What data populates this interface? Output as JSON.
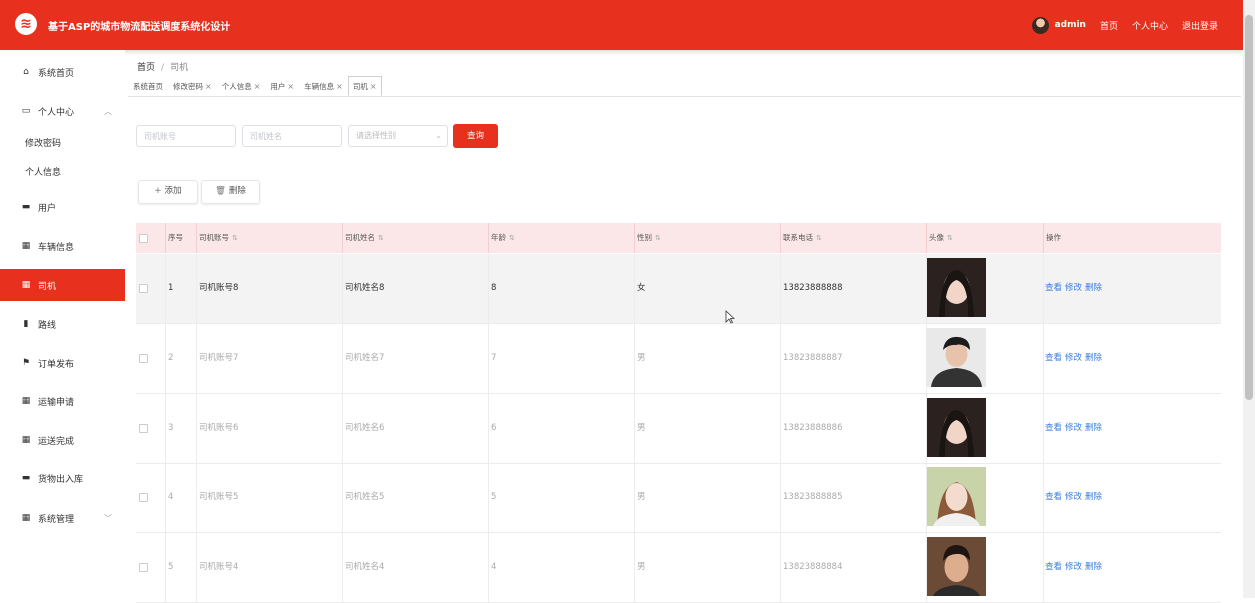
{
  "header": {
    "title": "基于ASP的城市物流配送调度系统化设计",
    "username": "admin",
    "links": [
      "首页",
      "个人中心",
      "退出登录"
    ]
  },
  "sidebar": {
    "items": [
      {
        "label": "系统首页",
        "icon": "home-icon"
      },
      {
        "label": "个人中心",
        "icon": "user-card-icon"
      },
      {
        "label": "用户",
        "icon": "monitor-icon"
      },
      {
        "label": "车辆信息",
        "icon": "grid-icon"
      },
      {
        "label": "司机",
        "icon": "grid-icon"
      },
      {
        "label": "路线",
        "icon": "clipboard-icon"
      },
      {
        "label": "订单发布",
        "icon": "flag-icon"
      },
      {
        "label": "运输申请",
        "icon": "grid-icon"
      },
      {
        "label": "运送完成",
        "icon": "grid-icon"
      },
      {
        "label": "货物出入库",
        "icon": "monitor-icon"
      },
      {
        "label": "系统管理",
        "icon": "grid-icon"
      }
    ],
    "sub_items": [
      "修改密码",
      "个人信息"
    ]
  },
  "breadcrumb": {
    "home": "首页",
    "separator": "/",
    "current": "司机"
  },
  "tabs": [
    {
      "label": "系统首页",
      "closable": false
    },
    {
      "label": "修改密码",
      "closable": true
    },
    {
      "label": "个人信息",
      "closable": true
    },
    {
      "label": "用户",
      "closable": true
    },
    {
      "label": "车辆信息",
      "closable": true
    },
    {
      "label": "司机",
      "closable": true,
      "active": true
    }
  ],
  "filters": {
    "account_placeholder": "司机账号",
    "name_placeholder": "司机姓名",
    "gender_placeholder": "请选择性别",
    "search_label": "查询"
  },
  "actions": {
    "add_label": "添加",
    "delete_label": "删除"
  },
  "table": {
    "columns": [
      "序号",
      "司机账号",
      "司机姓名",
      "年龄",
      "性别",
      "联系电话",
      "头像",
      "操作"
    ],
    "row_actions": [
      "查看",
      "修改",
      "删除"
    ],
    "rows": [
      {
        "index": "1",
        "account": "司机账号8",
        "name": "司机姓名8",
        "age": "8",
        "gender": "女",
        "phone": "13823888888"
      },
      {
        "index": "2",
        "account": "司机账号7",
        "name": "司机姓名7",
        "age": "7",
        "gender": "男",
        "phone": "13823888887"
      },
      {
        "index": "3",
        "account": "司机账号6",
        "name": "司机姓名6",
        "age": "6",
        "gender": "男",
        "phone": "13823888886"
      },
      {
        "index": "4",
        "account": "司机账号5",
        "name": "司机姓名5",
        "age": "5",
        "gender": "男",
        "phone": "13823888885"
      },
      {
        "index": "5",
        "account": "司机账号4",
        "name": "司机姓名4",
        "age": "4",
        "gender": "男",
        "phone": "13823888884"
      }
    ]
  },
  "colors": {
    "accent": "#e8301e",
    "header_row": "#fbe7e7",
    "link": "#3b7ddd"
  }
}
